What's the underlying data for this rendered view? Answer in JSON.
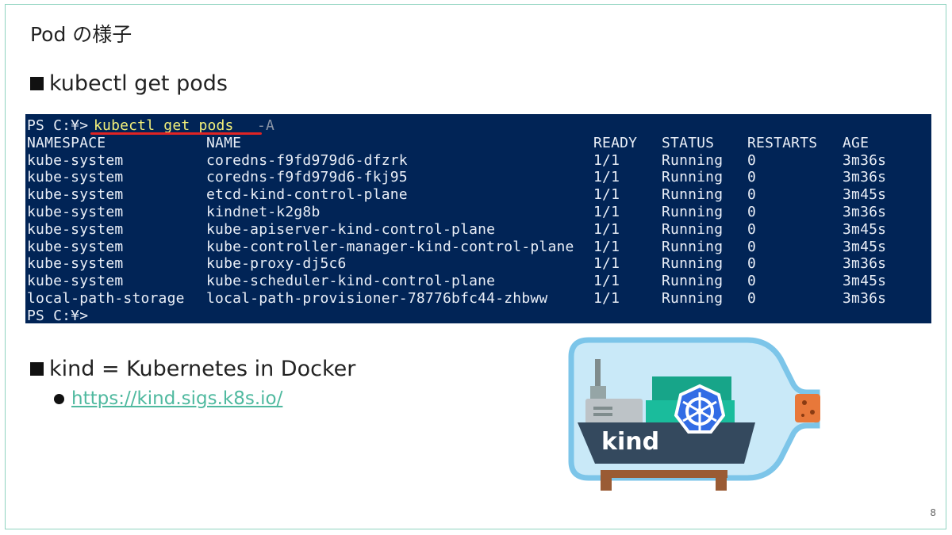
{
  "slide": {
    "title": "Pod の様子",
    "page_number": "8"
  },
  "bullets": {
    "first": "kubectl get pods",
    "second": "kind = Kubernetes in Docker",
    "link": "https://kind.sigs.k8s.io/"
  },
  "terminal": {
    "prompt": "PS C:¥>",
    "command": "kubectl get pods",
    "flag": "-A",
    "final_prompt": "PS C:¥>",
    "headers": {
      "namespace": "NAMESPACE",
      "name": "NAME",
      "ready": "READY",
      "status": "STATUS",
      "restarts": "RESTARTS",
      "age": "AGE"
    },
    "rows": [
      {
        "namespace": "kube-system",
        "name": "coredns-f9fd979d6-dfzrk",
        "ready": "1/1",
        "status": "Running",
        "restarts": "0",
        "age": "3m36s"
      },
      {
        "namespace": "kube-system",
        "name": "coredns-f9fd979d6-fkj95",
        "ready": "1/1",
        "status": "Running",
        "restarts": "0",
        "age": "3m36s"
      },
      {
        "namespace": "kube-system",
        "name": "etcd-kind-control-plane",
        "ready": "1/1",
        "status": "Running",
        "restarts": "0",
        "age": "3m45s"
      },
      {
        "namespace": "kube-system",
        "name": "kindnet-k2g8b",
        "ready": "1/1",
        "status": "Running",
        "restarts": "0",
        "age": "3m36s"
      },
      {
        "namespace": "kube-system",
        "name": "kube-apiserver-kind-control-plane",
        "ready": "1/1",
        "status": "Running",
        "restarts": "0",
        "age": "3m45s"
      },
      {
        "namespace": "kube-system",
        "name": "kube-controller-manager-kind-control-plane",
        "ready": "1/1",
        "status": "Running",
        "restarts": "0",
        "age": "3m45s"
      },
      {
        "namespace": "kube-system",
        "name": "kube-proxy-dj5c6",
        "ready": "1/1",
        "status": "Running",
        "restarts": "0",
        "age": "3m36s"
      },
      {
        "namespace": "kube-system",
        "name": "kube-scheduler-kind-control-plane",
        "ready": "1/1",
        "status": "Running",
        "restarts": "0",
        "age": "3m45s"
      },
      {
        "namespace": "local-path-storage",
        "name": "local-path-provisioner-78776bfc44-zhbww",
        "ready": "1/1",
        "status": "Running",
        "restarts": "0",
        "age": "3m36s"
      }
    ]
  },
  "logo": {
    "text": "kind",
    "icon": "kubernetes-helm-icon"
  },
  "colors": {
    "terminal_bg": "#012456",
    "command_highlight": "#f3f07a",
    "link": "#4fb99f",
    "frame": "#8fd3c0"
  }
}
